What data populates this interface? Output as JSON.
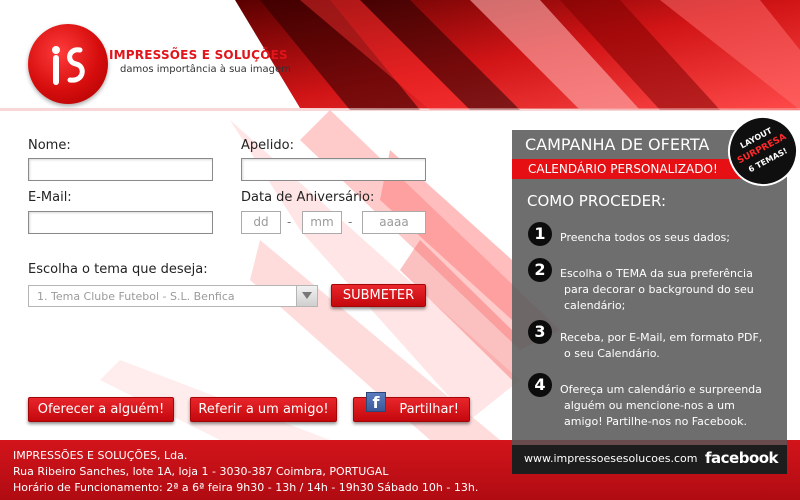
{
  "brand": {
    "name": "IMPRESSÕES E SOLUÇÕES",
    "tagline": "damos importância à sua imagem"
  },
  "form": {
    "nome_label": "Nome:",
    "apelido_label": "Apelido:",
    "email_label": "E-Mail:",
    "birthday_label": "Data de Aniversário:",
    "day_placeholder": "dd",
    "month_placeholder": "mm",
    "year_placeholder": "aaaa",
    "date_separator": "-",
    "theme_label": "Escolha o tema que deseja:",
    "theme_selected": "1. Tema Clube Futebol - S.L. Benfica",
    "submit_label": "SUBMETER"
  },
  "actions": {
    "offer_label": "Oferecer a alguém!",
    "refer_label": "Referir a um amigo!",
    "share_label": "Partilhar!",
    "share_icon": "facebook-f-icon"
  },
  "campaign": {
    "title": "CAMPANHA DE OFERTA",
    "subtitle": "CALENDÁRIO PERSONALIZADO!",
    "badge": {
      "line1": "LAYOUT",
      "line2": "SURPRESA",
      "line3": "6 TEMAS!"
    },
    "how_title": "COMO PROCEDER:",
    "steps": [
      {
        "num": "1",
        "line1": "Preencha todos os seus dados;"
      },
      {
        "num": "2",
        "line1": "Escolha o TEMA da sua preferência",
        "line2": "para decorar o background do seu",
        "line3": "calendário;"
      },
      {
        "num": "3",
        "line1": "Receba, por E-Mail, em formato PDF,",
        "line2": "o seu Calendário."
      },
      {
        "num": "4",
        "line1": "Ofereça um calendário e surpreenda",
        "line2": "alguém ou mencione-nos a um",
        "line3": "amigo! Partilhe-nos no Facebook."
      }
    ],
    "website": "www.impressoesesolucoes.com",
    "facebook_word": "facebook"
  },
  "footer": {
    "company": "IMPRESSÕES E SOLUÇÕES, Lda.",
    "address": "Rua Ribeiro Sanches, lote 1A, loja 1 - 3030-387 Coimbra, PORTUGAL",
    "hours": "Horário de Funcionamento:  2ª a 6ª feira 9h30 - 13h / 14h - 19h30   Sábado 10h - 13h."
  },
  "colors": {
    "brand_red": "#e0141a",
    "button_red": "#d8151a",
    "panel_gray": "#565656",
    "footer_red": "#c8101a"
  }
}
